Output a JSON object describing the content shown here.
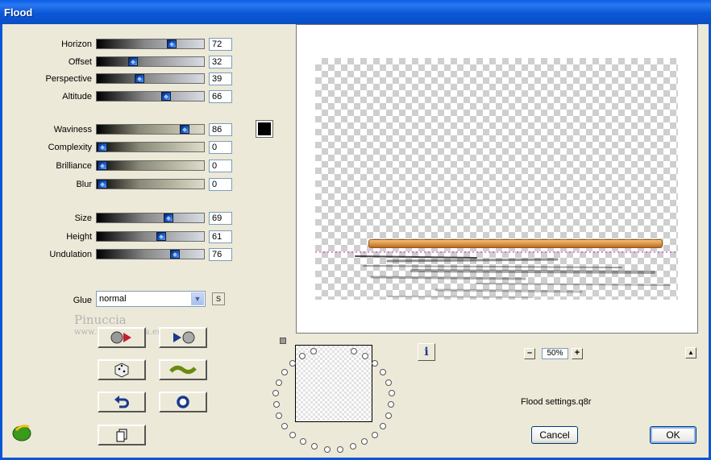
{
  "window": {
    "title": "Flood"
  },
  "sliders": [
    {
      "id": "horizon",
      "label": "Horizon",
      "value": "72",
      "fraction": 0.72,
      "style": "gray"
    },
    {
      "id": "offset",
      "label": "Offset",
      "value": "32",
      "fraction": 0.32,
      "style": "gray"
    },
    {
      "id": "perspective",
      "label": "Perspective",
      "value": "39",
      "fraction": 0.39,
      "style": "gray"
    },
    {
      "id": "altitude",
      "label": "Altitude",
      "value": "66",
      "fraction": 0.66,
      "style": "gray"
    },
    {
      "id": "waviness",
      "label": "Waviness",
      "value": "86",
      "fraction": 0.86,
      "style": "green"
    },
    {
      "id": "complexity",
      "label": "Complexity",
      "value": "0",
      "fraction": 0,
      "style": "green"
    },
    {
      "id": "brilliance",
      "label": "Brilliance",
      "value": "0",
      "fraction": 0,
      "style": "green"
    },
    {
      "id": "blur",
      "label": "Blur",
      "value": "0",
      "fraction": 0,
      "style": "green"
    },
    {
      "id": "size",
      "label": "Size",
      "value": "69",
      "fraction": 0.69,
      "style": "gray"
    },
    {
      "id": "height",
      "label": "Height",
      "value": "61",
      "fraction": 0.61,
      "style": "gray"
    },
    {
      "id": "undulation",
      "label": "Undulation",
      "value": "76",
      "fraction": 0.76,
      "style": "gray"
    }
  ],
  "color_swatch": "#000000",
  "glue": {
    "label": "Glue",
    "value": "normal",
    "s_label": "S"
  },
  "watermark": {
    "line1": "Pinuccia",
    "line2": "www.magicgrafica.eu"
  },
  "tool_buttons": [
    {
      "id": "reset",
      "icon": "preset-reset-icon"
    },
    {
      "id": "play",
      "icon": "play-preset-icon"
    },
    {
      "id": "random",
      "icon": "dice-icon"
    },
    {
      "id": "wave",
      "icon": "wave-icon"
    },
    {
      "id": "undo",
      "icon": "undo-arrow-icon"
    },
    {
      "id": "circle",
      "icon": "circle-icon"
    },
    {
      "id": "copy",
      "icon": "copy-icon"
    }
  ],
  "zoom": {
    "value": "50%",
    "minus": "–",
    "plus": "+"
  },
  "info_label": "i",
  "settings_file": "Flood settings.q8r",
  "buttons": {
    "cancel": "Cancel",
    "ok": "OK"
  },
  "colors": {
    "title_blue": "#0a5ee8",
    "orange_bar": "#d98d3e"
  }
}
